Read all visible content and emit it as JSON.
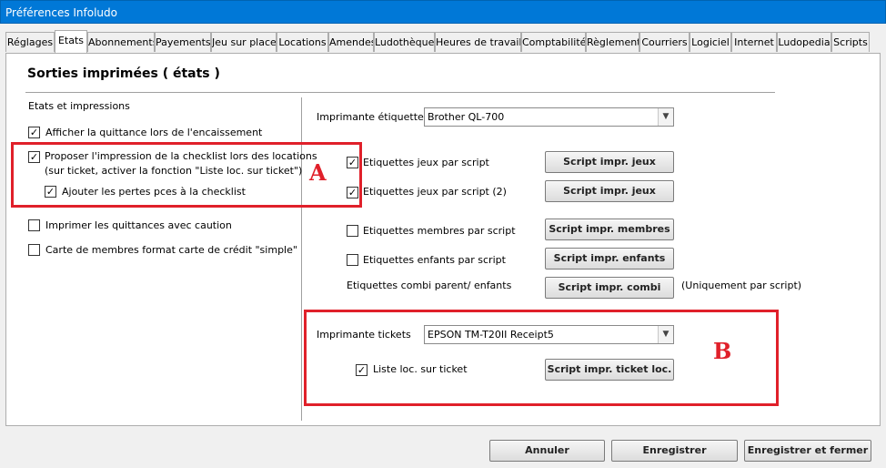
{
  "window": {
    "title": "Préférences Infoludo"
  },
  "tabs": [
    "Réglages",
    "Etats",
    "Abonnements",
    "Payements",
    "Jeu sur place",
    "Locations",
    "Amendes",
    "Ludothèque",
    "Heures de travail",
    "Comptabilité",
    "Règlement",
    "Courriers",
    "Logiciel",
    "Internet",
    "Ludopedia",
    "Scripts"
  ],
  "active_tab": "Etats",
  "page_title": "Sorties imprimées ( états )",
  "left": {
    "group_label": "Etats et impressions",
    "cb_quittance": {
      "label": "Afficher la quittance lors de l'encaissement",
      "checked": true
    },
    "cb_checklist": {
      "label_line1": "Proposer l'impression de la checklist lors des locations",
      "label_line2": "(sur ticket, activer la fonction \"Liste loc. sur ticket\")",
      "checked": true
    },
    "cb_pertes": {
      "label": "Ajouter les pertes pces à la checklist",
      "checked": true
    },
    "cb_caution": {
      "label": "Imprimer les quittances avec caution",
      "checked": false
    },
    "cb_carte": {
      "label": "Carte de membres format carte de crédit \"simple\"",
      "checked": false
    }
  },
  "right": {
    "printer_labels_label": "Imprimante étiquettes",
    "printer_labels_value": "Brother QL-700",
    "cb_jeux": {
      "label": "Etiquettes jeux par script",
      "checked": true
    },
    "btn_jeux": "Script impr. jeux",
    "cb_jeux2": {
      "label": "Etiquettes jeux par script (2)",
      "checked": true
    },
    "btn_jeux2": "Script impr. jeux",
    "cb_membres": {
      "label": "Etiquettes membres par script",
      "checked": false
    },
    "btn_membres": "Script impr. membres",
    "cb_enfants": {
      "label": "Etiquettes enfants par script",
      "checked": false
    },
    "btn_enfants": "Script impr. enfants",
    "combi_label": "Etiquettes combi parent/ enfants",
    "btn_combi": "Script impr. combi",
    "combi_note": "(Uniquement par script)",
    "printer_tickets_label": "Imprimante tickets",
    "printer_tickets_value": "EPSON TM-T20II Receipt5",
    "cb_liste": {
      "label": "Liste loc. sur ticket",
      "checked": true
    },
    "btn_ticket": "Script impr. ticket loc."
  },
  "footer": {
    "cancel": "Annuler",
    "save": "Enregistrer",
    "save_close": "Enregistrer et fermer"
  },
  "annotations": {
    "a": "A",
    "b": "B"
  },
  "check_glyph": "✓",
  "colors": {
    "titlebar": "#0078d7",
    "annotation": "#e0202a"
  }
}
